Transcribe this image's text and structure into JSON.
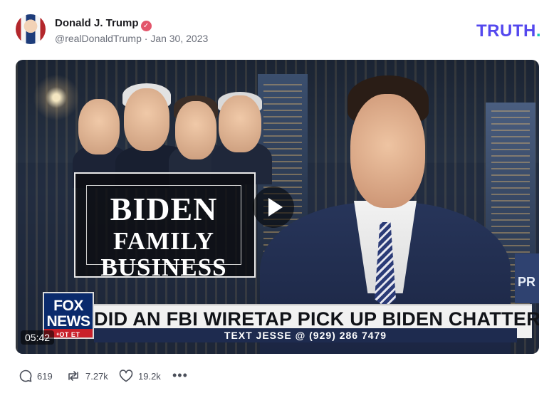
{
  "post": {
    "author": {
      "display_name": "Donald J. Trump",
      "verified_icon": "verified-badge-icon",
      "handle": "@realDonaldTrump",
      "separator": "·",
      "date": "Jan 30, 2023"
    },
    "brand": {
      "name": "TRUTH",
      "dot": ".",
      "colors": {
        "primary": "#5448ee",
        "dot": "#17c6b5"
      }
    },
    "video": {
      "duration": "05:42",
      "play_icon": "play-icon",
      "graphic": {
        "line1": "BIDEN",
        "line2": "FAMILY",
        "line3": "BUSINESS"
      },
      "chyron": {
        "headline": "DID AN FBI WIRETAP PICK UP BIDEN CHATTER?",
        "subline": "TEXT JESSE @ (929) 286 7479"
      },
      "network_logo": {
        "line1": "FOX",
        "line2": "NEWS",
        "tag": "ᵉOT ET"
      },
      "side_text": "PR"
    },
    "actions": {
      "replies": "619",
      "retruths": "7.27k",
      "likes": "19.2k",
      "more_label": "•••"
    }
  }
}
